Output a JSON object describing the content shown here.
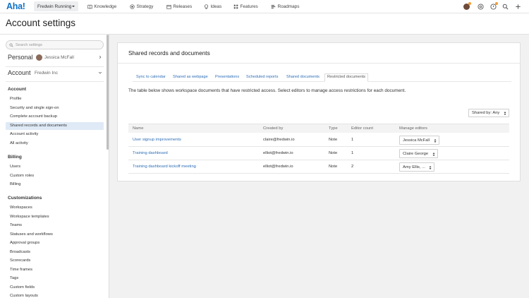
{
  "topbar": {
    "logo": "Aha!",
    "workspace": "Fredwin Running",
    "nav": [
      {
        "label": "Knowledge",
        "icon": "book-icon"
      },
      {
        "label": "Strategy",
        "icon": "target-icon"
      },
      {
        "label": "Releases",
        "icon": "calendar-icon"
      },
      {
        "label": "Ideas",
        "icon": "lightbulb-icon"
      },
      {
        "label": "Features",
        "icon": "grid-icon"
      },
      {
        "label": "Roadmaps",
        "icon": "roadmap-icon"
      }
    ],
    "badge_color": "#f29c38"
  },
  "header": {
    "title": "Account settings"
  },
  "sidebar": {
    "search_placeholder": "Search settings",
    "personal": {
      "label": "Personal",
      "user": "Jessica McFall"
    },
    "account": {
      "label": "Account",
      "org": "Fredwin Inc"
    },
    "groups": [
      {
        "heading": "Account",
        "items": [
          "Profile",
          "Security and single sign-on",
          "Complete account backup",
          "Shared records and documents",
          "Account activity",
          "All activity"
        ]
      },
      {
        "heading": "Billing",
        "items": [
          "Users",
          "Custom roles",
          "Billing"
        ]
      },
      {
        "heading": "Customizations",
        "items": [
          "Workspaces",
          "Workspace templates",
          "Teams",
          "Statuses and workflows",
          "Approval groups",
          "Broadcasts",
          "Scorecards",
          "Time frames",
          "Tags",
          "Custom fields",
          "Custom layouts"
        ]
      }
    ],
    "active_item": "Shared records and documents",
    "active_color": "#dfeaf6"
  },
  "main": {
    "card_title": "Shared records and documents",
    "tabs": [
      "Sync to calendar",
      "Shared as webpage",
      "Presentations",
      "Scheduled reports",
      "Shared documents",
      "Restricted documents"
    ],
    "active_tab": "Restricted documents",
    "description": "The table below shows workspace documents that have restricted access. Select editors to manage access restrictions for each document.",
    "filter": "Shared by: Any",
    "columns": [
      "Name",
      "Created by",
      "Type",
      "Editor count",
      "Manage editors"
    ],
    "rows": [
      {
        "name": "User signup improvements",
        "created_by": "claire@fredwin.io",
        "type": "Note",
        "editor_count": "1",
        "editors": "Jessica McFall"
      },
      {
        "name": "Training dashboard",
        "created_by": "elliot@fredwin.io",
        "type": "Note",
        "editor_count": "1",
        "editors": "Claire George"
      },
      {
        "name": "Training dashboard kickoff meeting",
        "created_by": "elliot@fredwin.io",
        "type": "Note",
        "editor_count": "2",
        "editors": "Amy Ellis, ..."
      }
    ],
    "link_color": "#2f6fb6"
  }
}
